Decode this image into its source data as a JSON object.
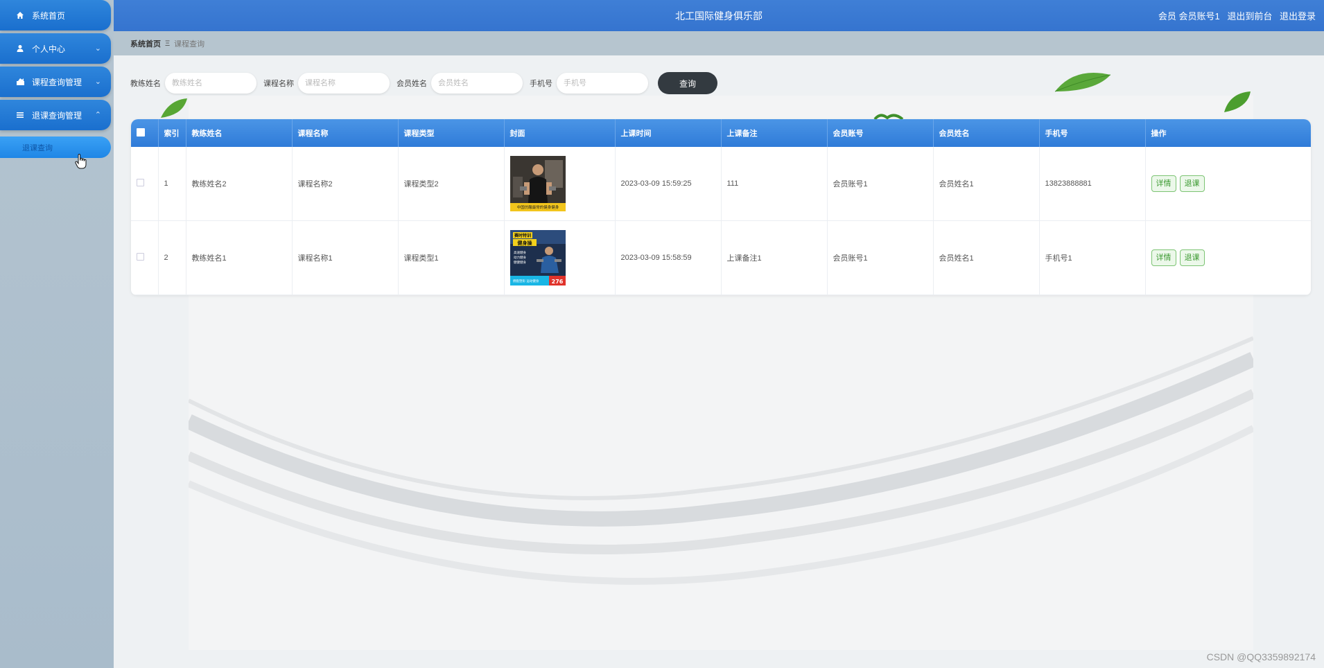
{
  "sidebar": {
    "items": [
      {
        "label": "系统首页",
        "icon": "home-icon"
      },
      {
        "label": "个人中心",
        "icon": "user-icon"
      },
      {
        "label": "课程查询管理",
        "icon": "course-icon"
      },
      {
        "label": "退课查询管理",
        "icon": "list-icon"
      }
    ],
    "submenu": {
      "label": "退课查询"
    }
  },
  "header": {
    "title": "北工国际健身俱乐部",
    "user": "会员 会员账号1",
    "to_front": "退出到前台",
    "logout": "退出登录"
  },
  "breadcrumb": {
    "home": "系统首页",
    "sep": "Ξ",
    "current": "课程查询"
  },
  "search": {
    "coach_label": "教练姓名",
    "coach_placeholder": "教练姓名",
    "course_label": "课程名称",
    "course_placeholder": "课程名称",
    "member_label": "会员姓名",
    "member_placeholder": "会员姓名",
    "phone_label": "手机号",
    "phone_placeholder": "手机号",
    "button": "查询"
  },
  "table": {
    "columns": [
      "索引",
      "教练姓名",
      "课程名称",
      "课程类型",
      "封面",
      "上课时间",
      "上课备注",
      "会员账号",
      "会员姓名",
      "手机号",
      "操作"
    ],
    "rows": [
      {
        "index": "1",
        "coach": "教练姓名2",
        "course": "课程名称2",
        "type": "课程类型2",
        "time": "2023-03-09 15:59:25",
        "note": "111",
        "account": "会员账号1",
        "member": "会员姓名1",
        "phone": "13823888881",
        "detail": "详情",
        "withdraw": "退课"
      },
      {
        "index": "2",
        "coach": "教练姓名1",
        "course": "课程名称1",
        "type": "课程类型1",
        "time": "2023-03-09 15:58:59",
        "note": "上课备注1",
        "account": "会员账号1",
        "member": "会员姓名1",
        "phone": "手机号1",
        "detail": "详情",
        "withdraw": "退课"
      }
    ]
  },
  "cover1": {
    "caption": "中国仿酸最常的健身健身"
  },
  "cover2": {
    "line1": "赛时特训",
    "line2": "健身操",
    "line3": "高速健身",
    "line4": "动力健身",
    "line5": "健健健身",
    "footer": "燃脂塑形 运动健身",
    "badge": "276"
  },
  "watermark": "CSDN @QQ3359892174",
  "colors": {
    "header": "#3f7fd6",
    "sidebar_item": "#1a6fce",
    "op_button": "#3c9a31"
  }
}
